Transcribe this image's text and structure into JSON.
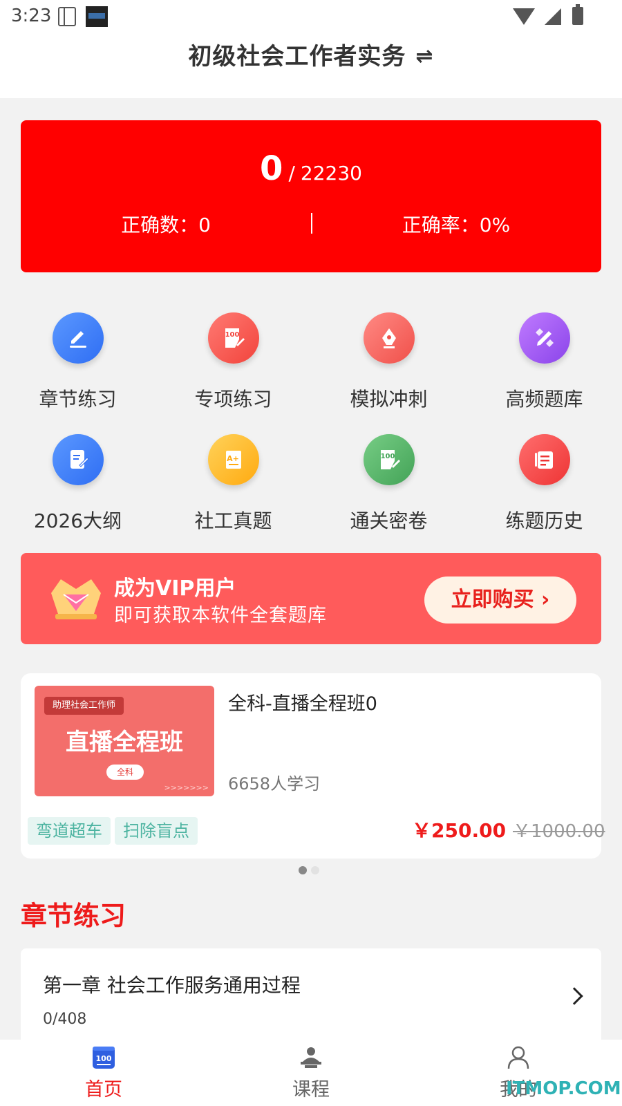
{
  "status_bar": {
    "time": "3:23"
  },
  "header": {
    "title": "初级社会工作者实务",
    "switch_icon": "switch-icon"
  },
  "stats": {
    "done": "0",
    "separator": "/",
    "total": "22230",
    "correct_label": "正确数：0",
    "rate_label": "正确率：0%",
    "background": "#ff0000"
  },
  "features": [
    {
      "label": "章节练习",
      "icon": "chapter-edit-icon",
      "color": "#3d7bfa"
    },
    {
      "label": "专项练习",
      "icon": "score-100-icon",
      "color": "#ff5f57"
    },
    {
      "label": "模拟冲刺",
      "icon": "pen-nib-icon",
      "color": "#ff6b66"
    },
    {
      "label": "高频题库",
      "icon": "pencil-badge-icon",
      "color": "#a45ff2"
    },
    {
      "label": "2026大纲",
      "icon": "document-edit-icon",
      "color": "#3d7bfa"
    },
    {
      "label": "社工真题",
      "icon": "exam-paper-icon",
      "color": "#ffbb29"
    },
    {
      "label": "通关密卷",
      "icon": "score-100-paper-icon",
      "color": "#5bb86b"
    },
    {
      "label": "练题历史",
      "icon": "history-list-icon",
      "color": "#ff5050"
    }
  ],
  "vip": {
    "title": "成为VIP用户",
    "subtitle": "即可获取本软件全套题库",
    "button": "立即购买 ›"
  },
  "course": {
    "cover_tag": "助理社会工作师",
    "cover_title": "直播全程班",
    "cover_sub": "全科",
    "cover_arrows": ">>>>>>>",
    "title": "全科-直播全程班0",
    "learners": "6658人学习",
    "tags": [
      "弯道超车",
      "扫除盲点"
    ],
    "price_now": "￥250.00",
    "price_old": "￥1000.00"
  },
  "section": {
    "title": "章节练习"
  },
  "chapters": [
    {
      "title": "第一章 社会工作服务通用过程",
      "progress": "0/408"
    }
  ],
  "bottom_nav": [
    {
      "label": "首页",
      "icon": "home-100-icon",
      "active": true
    },
    {
      "label": "课程",
      "icon": "teacher-icon",
      "active": false
    },
    {
      "label": "我的",
      "icon": "profile-icon",
      "active": false
    }
  ],
  "watermark": "ITMOP.COM"
}
